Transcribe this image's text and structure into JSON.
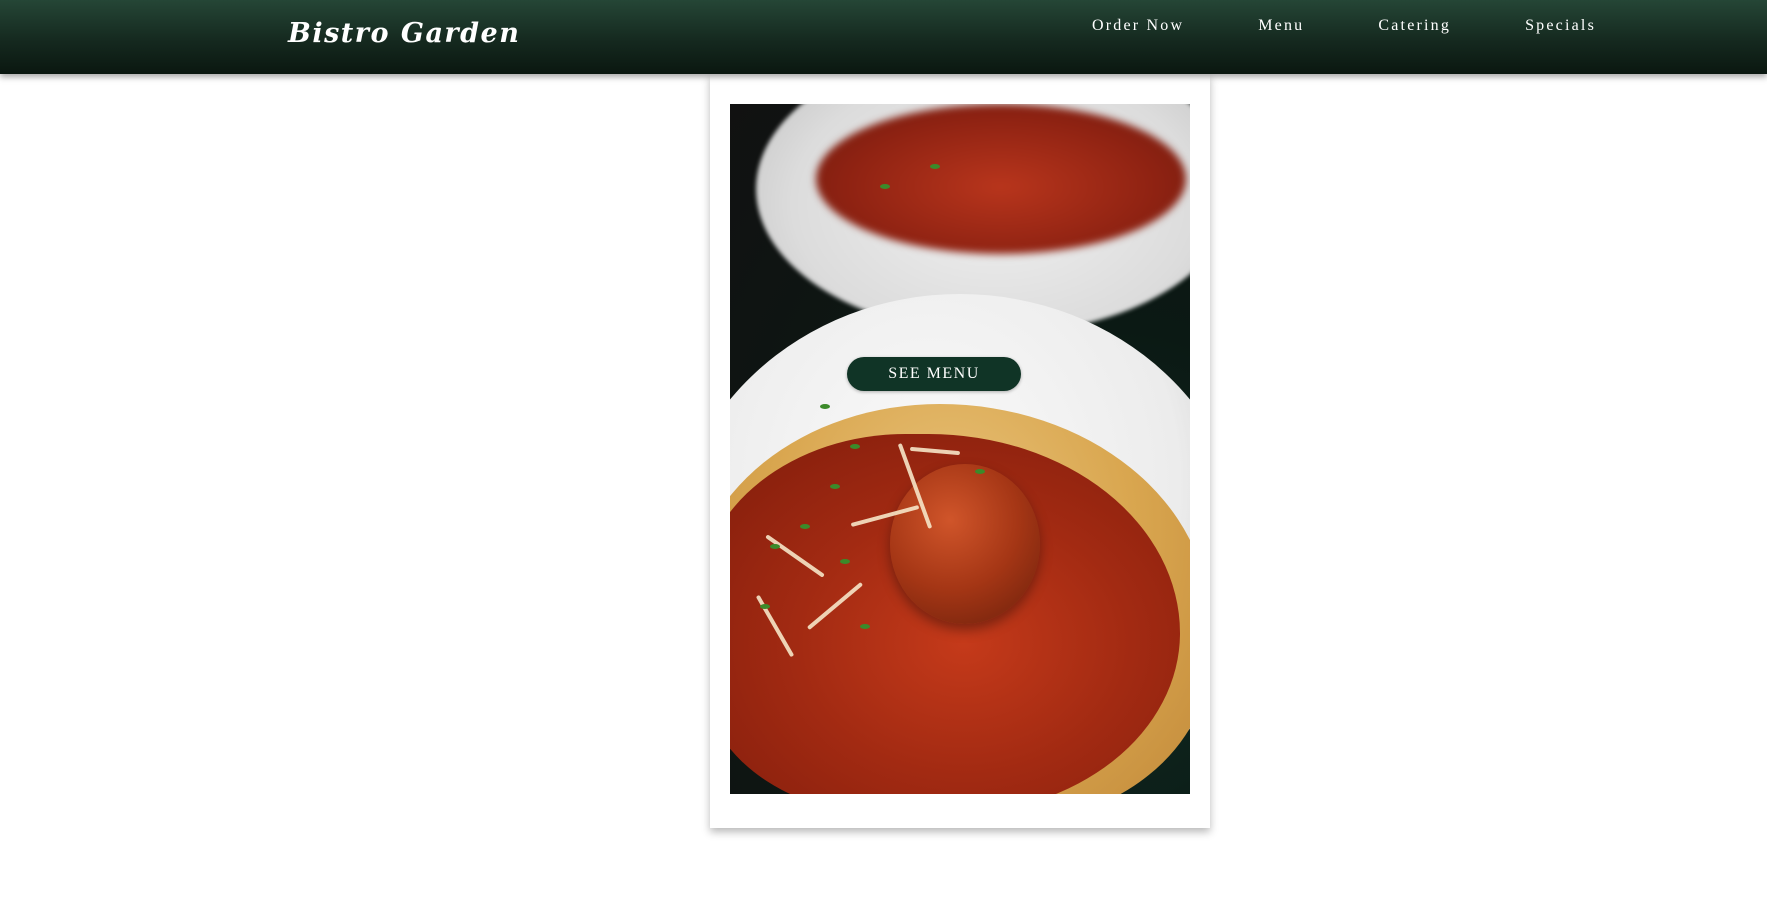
{
  "brand": {
    "name": "Bistro Garden"
  },
  "nav": {
    "items": [
      {
        "label": "Order Now"
      },
      {
        "label": "Menu"
      },
      {
        "label": "Catering"
      },
      {
        "label": "Specials"
      }
    ]
  },
  "card": {
    "button_label": "SEE MENU"
  },
  "colors": {
    "header_top": "#254636",
    "header_bottom": "#0a1710",
    "button_bg": "#103426",
    "text_light": "#ffffff"
  }
}
